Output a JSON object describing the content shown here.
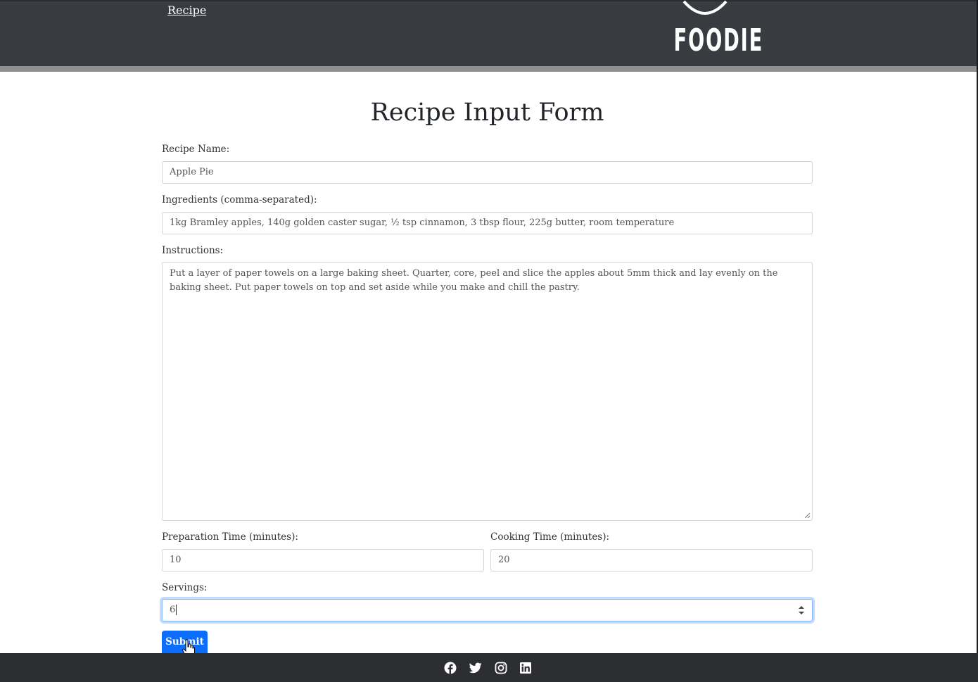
{
  "header": {
    "nav_link": "Recipe",
    "logo_text": "FOODIE"
  },
  "form": {
    "title": "Recipe Input Form",
    "recipe_name": {
      "label": "Recipe Name:",
      "value": "Apple Pie"
    },
    "ingredients": {
      "label": "Ingredients (comma-separated):",
      "value": "1kg Bramley apples, 140g golden caster sugar, ½ tsp cinnamon,  3 tbsp flour, 225g butter, room temperature"
    },
    "instructions": {
      "label": "Instructions:",
      "value": "Put a layer of paper towels on a large baking sheet. Quarter, core, peel and slice the apples about 5mm thick and lay evenly on the baking sheet. Put paper towels on top and set aside while you make and chill the pastry."
    },
    "prep_time": {
      "label": "Preparation Time (minutes):",
      "value": "10"
    },
    "cook_time": {
      "label": "Cooking Time (minutes):",
      "value": "20"
    },
    "servings": {
      "label": "Servings:",
      "value": "6"
    },
    "submit_label": "Submit"
  },
  "footer": {
    "social_icons": [
      "facebook-icon",
      "twitter-icon",
      "instagram-icon",
      "linkedin-icon"
    ]
  },
  "colors": {
    "header_bg": "#383b40",
    "footer_bg": "#2d2e31",
    "accent": "#0d6efd"
  }
}
